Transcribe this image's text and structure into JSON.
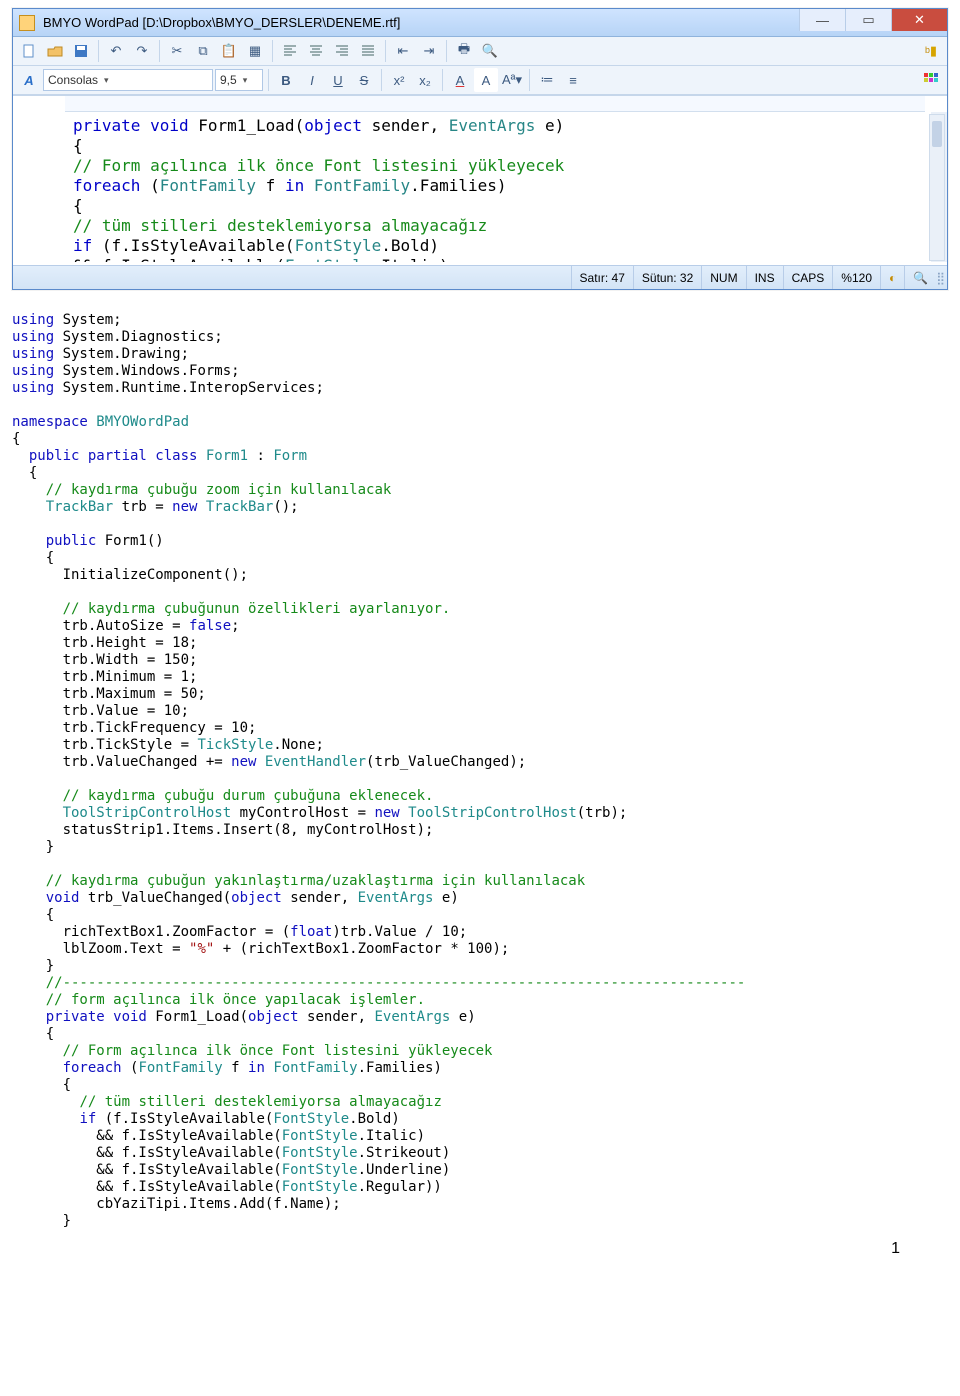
{
  "window": {
    "title": "BMYO WordPad [D:\\Dropbox\\BMYO_DERSLER\\DENEME.rtf]"
  },
  "toolbar2": {
    "font_combo": "Consolas",
    "size_combo": "9,5",
    "bold": "B",
    "italic": "I",
    "underline": "U",
    "strike": "S"
  },
  "editor_lines": [
    {
      "indent": 2,
      "parts": [
        {
          "t": "private void ",
          "c": "kw"
        },
        {
          "t": "Form1_Load(",
          "c": ""
        },
        {
          "t": "object ",
          "c": "kw"
        },
        {
          "t": "sender, ",
          "c": ""
        },
        {
          "t": "EventArgs ",
          "c": "type"
        },
        {
          "t": "e)",
          "c": ""
        }
      ]
    },
    {
      "indent": 2,
      "parts": [
        {
          "t": "{",
          "c": ""
        }
      ]
    },
    {
      "indent": 3,
      "parts": [
        {
          "t": "// Form açılınca ilk önce Font listesini yükleyecek",
          "c": "cm"
        }
      ]
    },
    {
      "indent": 3,
      "parts": [
        {
          "t": "foreach ",
          "c": "kw"
        },
        {
          "t": "(",
          "c": ""
        },
        {
          "t": "FontFamily ",
          "c": "type"
        },
        {
          "t": "f ",
          "c": ""
        },
        {
          "t": "in ",
          "c": "kw"
        },
        {
          "t": "FontFamily",
          "c": "type"
        },
        {
          "t": ".Families)",
          "c": ""
        }
      ]
    },
    {
      "indent": 3,
      "parts": [
        {
          "t": "{",
          "c": ""
        }
      ]
    },
    {
      "indent": 4,
      "parts": [
        {
          "t": "// tüm stilleri desteklemiyorsa almayacağız",
          "c": "cm"
        }
      ]
    },
    {
      "indent": 4,
      "parts": [
        {
          "t": "if ",
          "c": "kw"
        },
        {
          "t": "(f.IsStyleAvailable(",
          "c": ""
        },
        {
          "t": "FontStyle",
          "c": "type"
        },
        {
          "t": ".Bold)",
          "c": ""
        }
      ]
    },
    {
      "indent": 5,
      "parts": [
        {
          "t": "&& f.IsStyleAvailable(",
          "c": ""
        },
        {
          "t": "FontStyle",
          "c": "type"
        },
        {
          "t": ".Italic)",
          "c": ""
        }
      ]
    }
  ],
  "status": {
    "line_label": "Satır: 47",
    "col_label": "Sütun: 32",
    "num": "NUM",
    "ins": "INS",
    "caps": "CAPS",
    "zoom": "%120"
  },
  "code": {
    "lines": [
      [
        {
          "t": "using ",
          "c": "kw"
        },
        {
          "t": "System;",
          "c": ""
        }
      ],
      [
        {
          "t": "using ",
          "c": "kw"
        },
        {
          "t": "System.Diagnostics;",
          "c": ""
        }
      ],
      [
        {
          "t": "using ",
          "c": "kw"
        },
        {
          "t": "System.Drawing;",
          "c": ""
        }
      ],
      [
        {
          "t": "using ",
          "c": "kw"
        },
        {
          "t": "System.Windows.Forms;",
          "c": ""
        }
      ],
      [
        {
          "t": "using ",
          "c": "kw"
        },
        {
          "t": "System.Runtime.InteropServices;",
          "c": ""
        }
      ],
      [
        {
          "t": "",
          "c": ""
        }
      ],
      [
        {
          "t": "namespace ",
          "c": "kw"
        },
        {
          "t": "BMYOWordPad",
          "c": "type"
        }
      ],
      [
        {
          "t": "{",
          "c": ""
        }
      ],
      [
        {
          "t": "  ",
          "c": ""
        },
        {
          "t": "public partial class ",
          "c": "kw"
        },
        {
          "t": "Form1 ",
          "c": "type"
        },
        {
          "t": ": ",
          "c": ""
        },
        {
          "t": "Form",
          "c": "type"
        }
      ],
      [
        {
          "t": "  {",
          "c": ""
        }
      ],
      [
        {
          "t": "    ",
          "c": ""
        },
        {
          "t": "// kaydırma çubuğu zoom için kullanılacak",
          "c": "cm"
        }
      ],
      [
        {
          "t": "    ",
          "c": ""
        },
        {
          "t": "TrackBar ",
          "c": "type"
        },
        {
          "t": "trb = ",
          "c": ""
        },
        {
          "t": "new ",
          "c": "kw"
        },
        {
          "t": "TrackBar",
          "c": "type"
        },
        {
          "t": "();",
          "c": ""
        }
      ],
      [
        {
          "t": "",
          "c": ""
        }
      ],
      [
        {
          "t": "    ",
          "c": ""
        },
        {
          "t": "public ",
          "c": "kw"
        },
        {
          "t": "Form1()",
          "c": ""
        }
      ],
      [
        {
          "t": "    {",
          "c": ""
        }
      ],
      [
        {
          "t": "      InitializeComponent();",
          "c": ""
        }
      ],
      [
        {
          "t": "",
          "c": ""
        }
      ],
      [
        {
          "t": "      ",
          "c": ""
        },
        {
          "t": "// kaydırma çubuğunun özellikleri ayarlanıyor.",
          "c": "cm"
        }
      ],
      [
        {
          "t": "      trb.AutoSize = ",
          "c": ""
        },
        {
          "t": "false",
          "c": "kw"
        },
        {
          "t": ";",
          "c": ""
        }
      ],
      [
        {
          "t": "      trb.Height = 18;",
          "c": ""
        }
      ],
      [
        {
          "t": "      trb.Width = 150;",
          "c": ""
        }
      ],
      [
        {
          "t": "      trb.Minimum = 1;",
          "c": ""
        }
      ],
      [
        {
          "t": "      trb.Maximum = 50;",
          "c": ""
        }
      ],
      [
        {
          "t": "      trb.Value = 10;",
          "c": ""
        }
      ],
      [
        {
          "t": "      trb.TickFrequency = 10;",
          "c": ""
        }
      ],
      [
        {
          "t": "      trb.TickStyle = ",
          "c": ""
        },
        {
          "t": "TickStyle",
          "c": "type"
        },
        {
          "t": ".None;",
          "c": ""
        }
      ],
      [
        {
          "t": "      trb.ValueChanged += ",
          "c": ""
        },
        {
          "t": "new ",
          "c": "kw"
        },
        {
          "t": "EventHandler",
          "c": "type"
        },
        {
          "t": "(trb_ValueChanged);",
          "c": ""
        }
      ],
      [
        {
          "t": "",
          "c": ""
        }
      ],
      [
        {
          "t": "      ",
          "c": ""
        },
        {
          "t": "// kaydırma çubuğu durum çubuğuna eklenecek.",
          "c": "cm"
        }
      ],
      [
        {
          "t": "      ",
          "c": ""
        },
        {
          "t": "ToolStripControlHost ",
          "c": "type"
        },
        {
          "t": "myControlHost = ",
          "c": ""
        },
        {
          "t": "new ",
          "c": "kw"
        },
        {
          "t": "ToolStripControlHost",
          "c": "type"
        },
        {
          "t": "(trb);",
          "c": ""
        }
      ],
      [
        {
          "t": "      statusStrip1.Items.Insert(8, myControlHost);",
          "c": ""
        }
      ],
      [
        {
          "t": "    }",
          "c": ""
        }
      ],
      [
        {
          "t": "",
          "c": ""
        }
      ],
      [
        {
          "t": "    ",
          "c": ""
        },
        {
          "t": "// kaydırma çubuğun yakınlaştırma/uzaklaştırma için kullanılacak",
          "c": "cm"
        }
      ],
      [
        {
          "t": "    ",
          "c": ""
        },
        {
          "t": "void ",
          "c": "kw"
        },
        {
          "t": "trb_ValueChanged(",
          "c": ""
        },
        {
          "t": "object ",
          "c": "kw"
        },
        {
          "t": "sender, ",
          "c": ""
        },
        {
          "t": "EventArgs ",
          "c": "type"
        },
        {
          "t": "e)",
          "c": ""
        }
      ],
      [
        {
          "t": "    {",
          "c": ""
        }
      ],
      [
        {
          "t": "      richTextBox1.ZoomFactor = (",
          "c": ""
        },
        {
          "t": "float",
          "c": "kw"
        },
        {
          "t": ")trb.Value / 10;",
          "c": ""
        }
      ],
      [
        {
          "t": "      lblZoom.Text = ",
          "c": ""
        },
        {
          "t": "\"%\"",
          "c": "str"
        },
        {
          "t": " + (richTextBox1.ZoomFactor * 100);",
          "c": ""
        }
      ],
      [
        {
          "t": "    }",
          "c": ""
        }
      ],
      [
        {
          "t": "    ",
          "c": ""
        },
        {
          "t": "//---------------------------------------------------------------------------------",
          "c": "cm"
        }
      ],
      [
        {
          "t": "    ",
          "c": ""
        },
        {
          "t": "// form açılınca ilk önce yapılacak işlemler.",
          "c": "cm"
        }
      ],
      [
        {
          "t": "    ",
          "c": ""
        },
        {
          "t": "private void ",
          "c": "kw"
        },
        {
          "t": "Form1_Load(",
          "c": ""
        },
        {
          "t": "object ",
          "c": "kw"
        },
        {
          "t": "sender, ",
          "c": ""
        },
        {
          "t": "EventArgs ",
          "c": "type"
        },
        {
          "t": "e)",
          "c": ""
        }
      ],
      [
        {
          "t": "    {",
          "c": ""
        }
      ],
      [
        {
          "t": "      ",
          "c": ""
        },
        {
          "t": "// Form açılınca ilk önce Font listesini yükleyecek",
          "c": "cm"
        }
      ],
      [
        {
          "t": "      ",
          "c": ""
        },
        {
          "t": "foreach ",
          "c": "kw"
        },
        {
          "t": "(",
          "c": ""
        },
        {
          "t": "FontFamily ",
          "c": "type"
        },
        {
          "t": "f ",
          "c": ""
        },
        {
          "t": "in ",
          "c": "kw"
        },
        {
          "t": "FontFamily",
          "c": "type"
        },
        {
          "t": ".Families)",
          "c": ""
        }
      ],
      [
        {
          "t": "      {",
          "c": ""
        }
      ],
      [
        {
          "t": "        ",
          "c": ""
        },
        {
          "t": "// tüm stilleri desteklemiyorsa almayacağız",
          "c": "cm"
        }
      ],
      [
        {
          "t": "        ",
          "c": ""
        },
        {
          "t": "if ",
          "c": "kw"
        },
        {
          "t": "(f.IsStyleAvailable(",
          "c": ""
        },
        {
          "t": "FontStyle",
          "c": "type"
        },
        {
          "t": ".Bold)",
          "c": ""
        }
      ],
      [
        {
          "t": "          && f.IsStyleAvailable(",
          "c": ""
        },
        {
          "t": "FontStyle",
          "c": "type"
        },
        {
          "t": ".Italic)",
          "c": ""
        }
      ],
      [
        {
          "t": "          && f.IsStyleAvailable(",
          "c": ""
        },
        {
          "t": "FontStyle",
          "c": "type"
        },
        {
          "t": ".Strikeout)",
          "c": ""
        }
      ],
      [
        {
          "t": "          && f.IsStyleAvailable(",
          "c": ""
        },
        {
          "t": "FontStyle",
          "c": "type"
        },
        {
          "t": ".Underline)",
          "c": ""
        }
      ],
      [
        {
          "t": "          && f.IsStyleAvailable(",
          "c": ""
        },
        {
          "t": "FontStyle",
          "c": "type"
        },
        {
          "t": ".Regular))",
          "c": ""
        }
      ],
      [
        {
          "t": "          cbYaziTipi.Items.Add(f.Name);",
          "c": ""
        }
      ],
      [
        {
          "t": "      }",
          "c": ""
        }
      ]
    ]
  },
  "page_number": "1"
}
